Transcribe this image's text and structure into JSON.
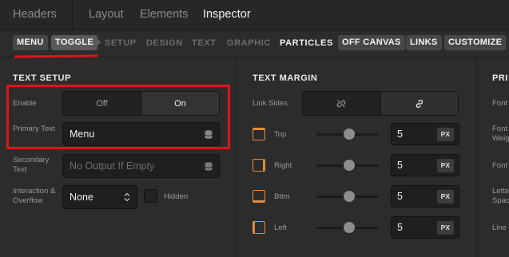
{
  "top_tabs": [
    "Headers",
    "Layout",
    "Elements",
    "Inspector"
  ],
  "sub_nav": {
    "items": [
      "MENU",
      "TOGGLE",
      "SETUP",
      "DESIGN",
      "TEXT",
      "GRAPHIC",
      "PARTICLES",
      "OFF CANVAS",
      "LINKS",
      "CUSTOMIZE"
    ],
    "active": "TOGGLE"
  },
  "text_setup": {
    "title": "TEXT SETUP",
    "enable": {
      "label": "Enable",
      "options": [
        "Off",
        "On"
      ],
      "selected": "On"
    },
    "primary_text": {
      "label": "Primary Text",
      "value": "Menu"
    },
    "secondary_text": {
      "label": "Secondary Text",
      "placeholder": "No Output If Empty"
    },
    "interaction": {
      "label": "Interaction & Overflow",
      "value": "None",
      "checkbox_label": "Hidden"
    }
  },
  "text_margin": {
    "title": "TEXT MARGIN",
    "link_sides_label": "Link Sides",
    "rows": [
      {
        "label": "Top",
        "value": "5",
        "unit": "PX"
      },
      {
        "label": "Right",
        "value": "5",
        "unit": "PX"
      },
      {
        "label": "Bttm",
        "value": "5",
        "unit": "PX"
      },
      {
        "label": "Left",
        "value": "5",
        "unit": "PX"
      }
    ]
  },
  "third_col": {
    "title": "PRI",
    "labels": [
      "Font",
      "Font Weig",
      "Font",
      "Lette Spac",
      "Line"
    ]
  },
  "colors": {
    "accent_orange": "#e38b3a",
    "annotation_red": "#e0141a"
  }
}
